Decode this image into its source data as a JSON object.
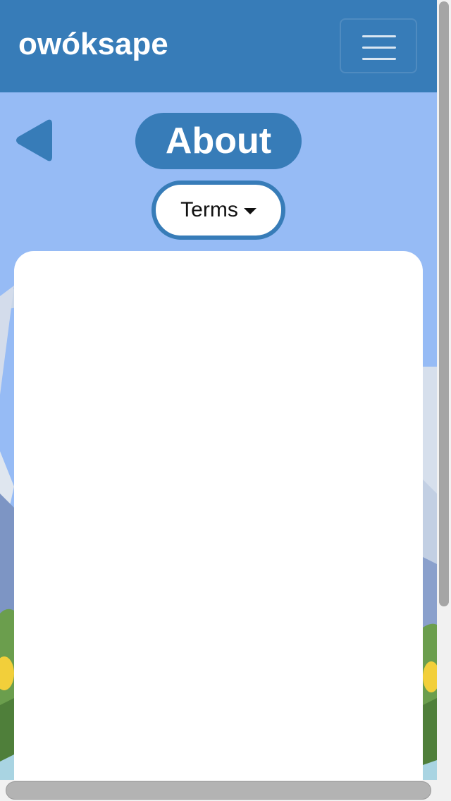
{
  "navbar": {
    "brand": "owóksape",
    "menu_icon": "hamburger-menu-icon"
  },
  "header": {
    "back_icon": "back-arrow-icon",
    "title": "About"
  },
  "dropdown": {
    "selected": "Terms",
    "caret_icon": "caret-down-icon"
  },
  "colors": {
    "primary": "#377cb8",
    "sky": "#96bbf5",
    "card": "#ffffff"
  }
}
